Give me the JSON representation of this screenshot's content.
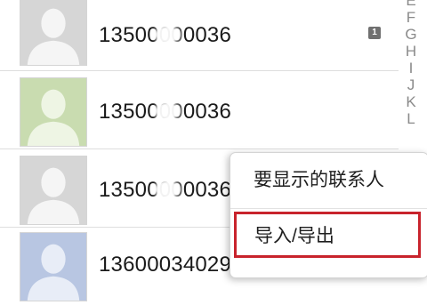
{
  "contacts": [
    {
      "number": "13500000036",
      "has_sim_badge": true
    },
    {
      "number": "13500000036",
      "has_sim_badge": false
    },
    {
      "number": "13500000036",
      "has_sim_badge": false
    },
    {
      "number": "13600034029",
      "has_sim_badge": false
    }
  ],
  "sim_badge": "1",
  "index_letters": [
    "E",
    "F",
    "G",
    "H",
    "I",
    "J",
    "K",
    "L"
  ],
  "menu": {
    "show_contacts_label": "要显示的联系人",
    "import_export_label": "导入/导出"
  },
  "colors": {
    "highlight_border": "#c8232c",
    "avatar_gray": "#d8d8d8",
    "avatar_green": "#c9dcb0",
    "avatar_blue": "#b8c6e2"
  }
}
